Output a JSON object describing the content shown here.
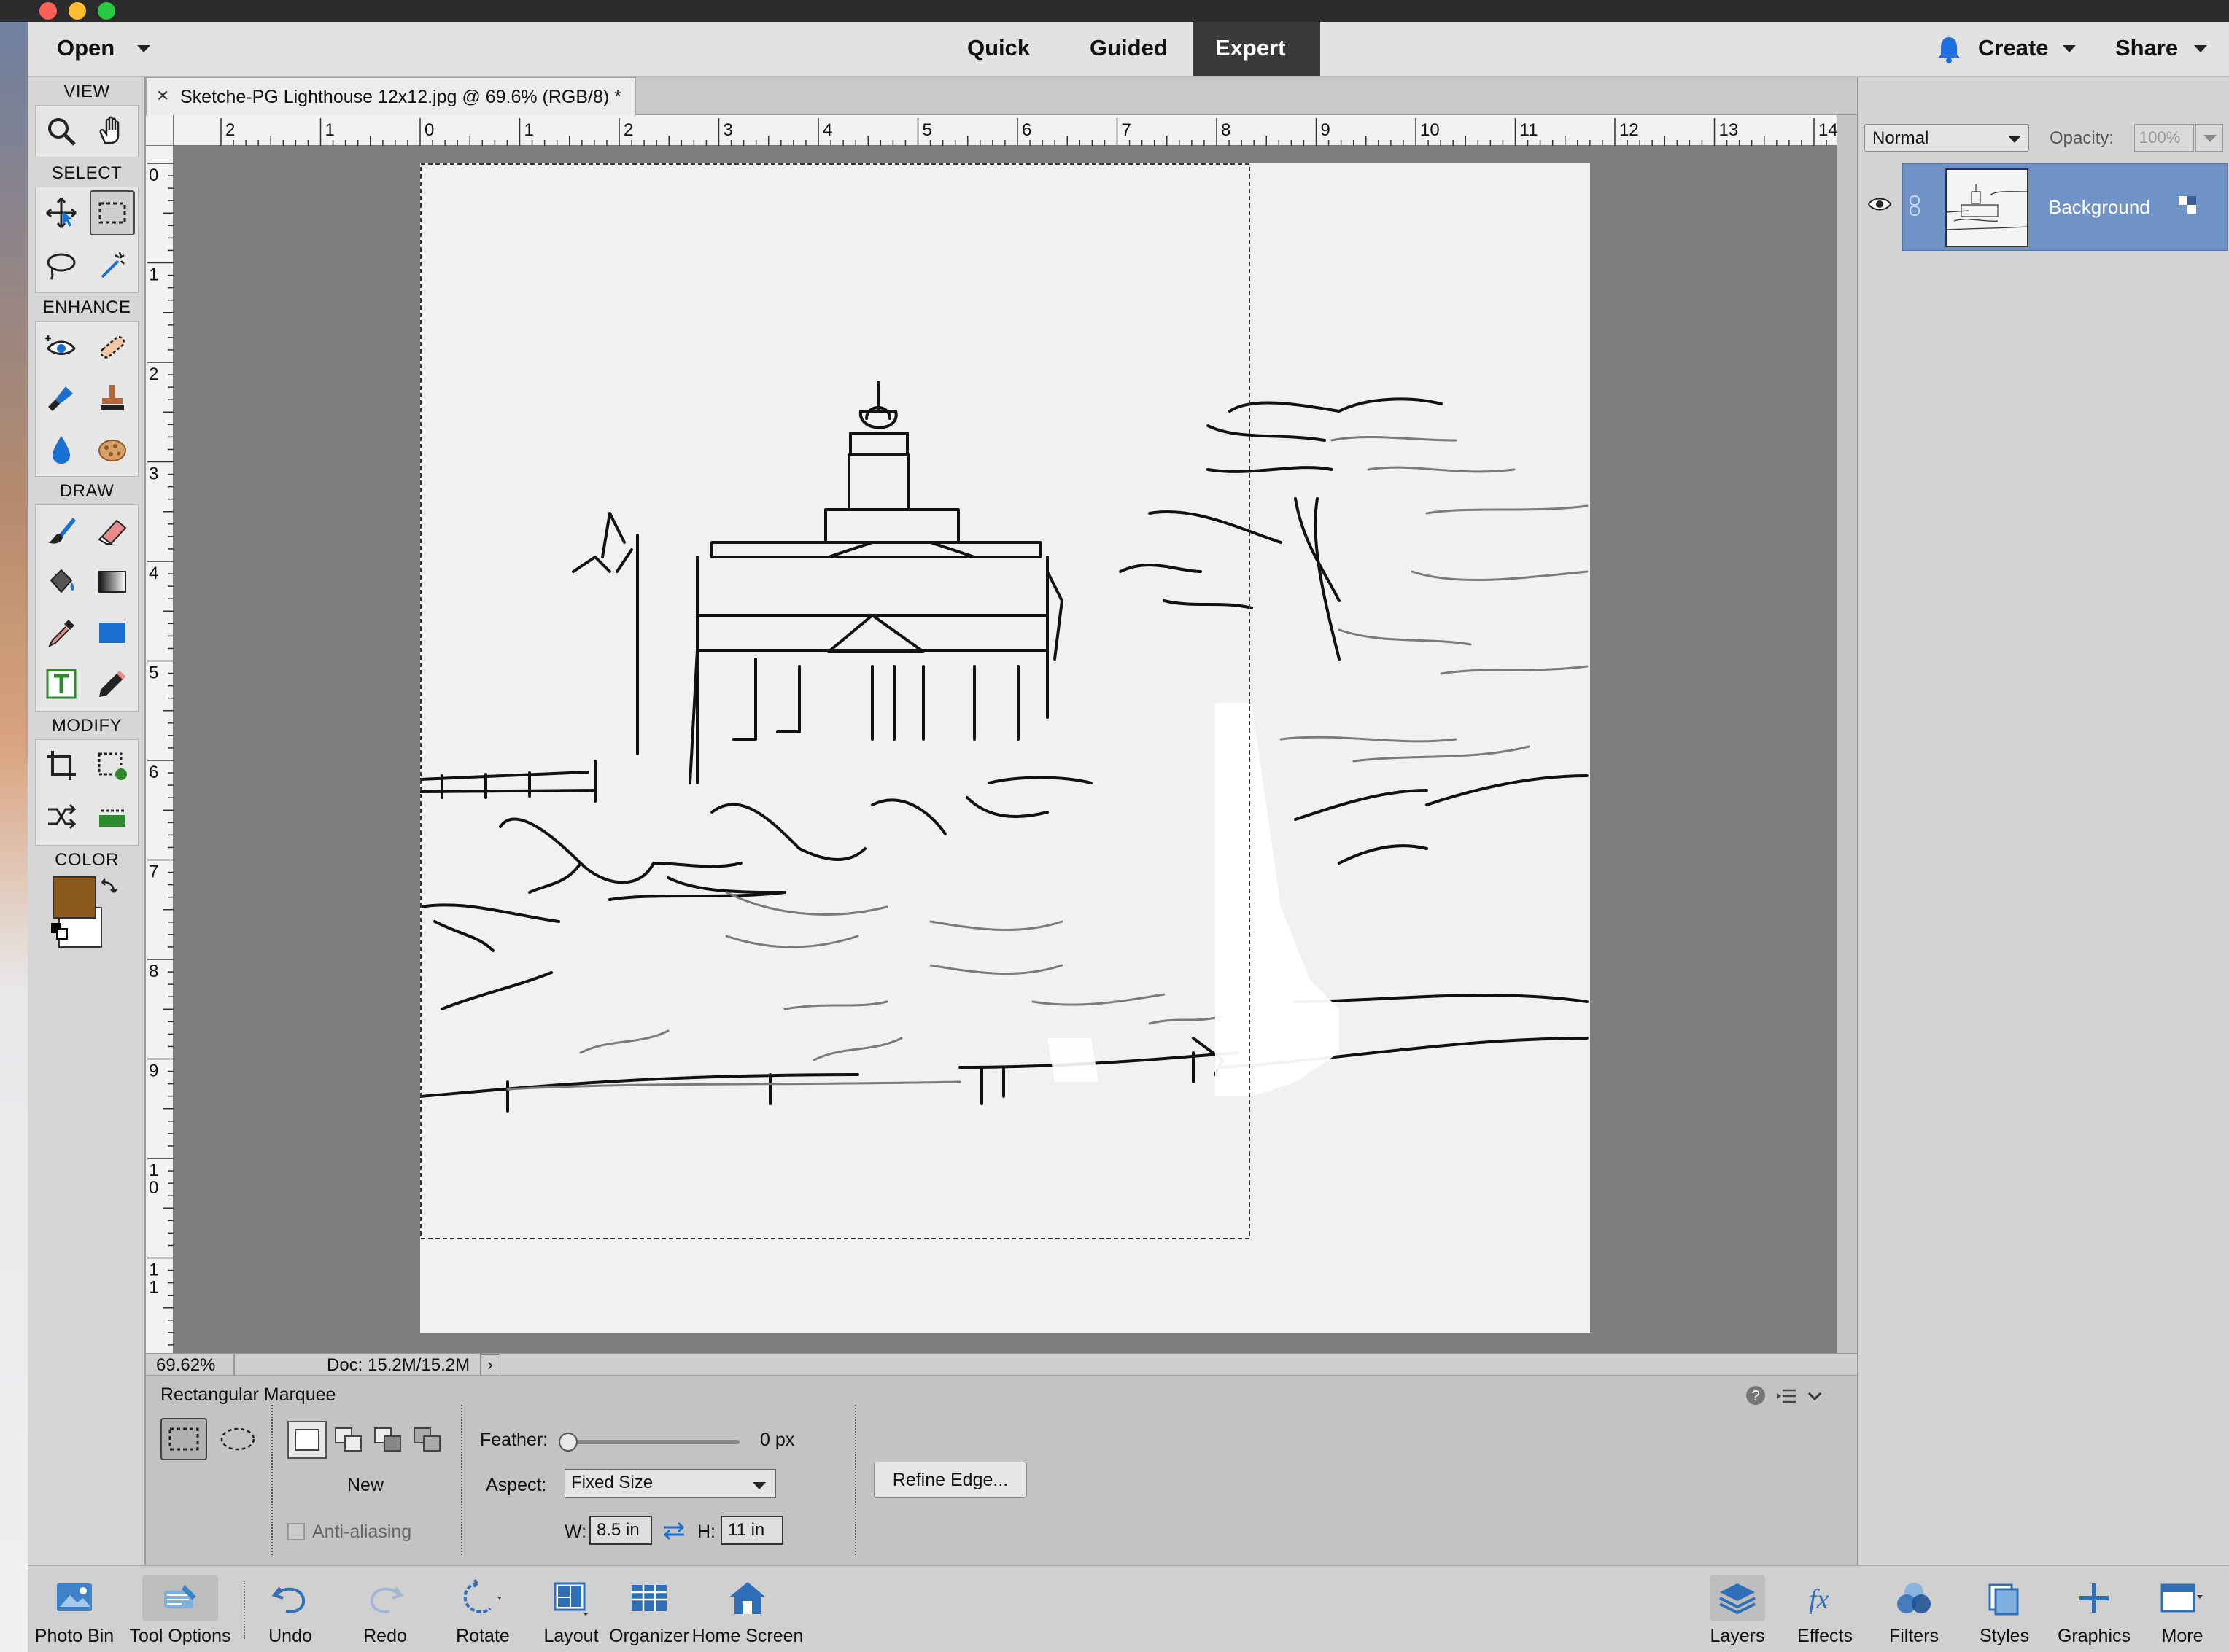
{
  "menubar": {
    "open_label": "Open",
    "modes": [
      "Quick",
      "Guided",
      "Expert"
    ],
    "active_mode": "Expert",
    "create_label": "Create",
    "share_label": "Share"
  },
  "document": {
    "tab_title": "Sketche-PG Lighthouse 12x12.jpg @ 69.6% (RGB/8) *",
    "close_glyph": "×"
  },
  "tools": {
    "sections": [
      "VIEW",
      "SELECT",
      "ENHANCE",
      "DRAW",
      "MODIFY",
      "COLOR"
    ],
    "foreground_color": "#8B5A1B",
    "background_color": "#ffffff"
  },
  "rulers": {
    "horizontal": [
      "2",
      "1",
      "0",
      "1",
      "2",
      "3",
      "4",
      "5",
      "6",
      "7",
      "8",
      "9",
      "10",
      "11",
      "12",
      "13",
      "14"
    ],
    "vertical": [
      "0",
      "1",
      "2",
      "3",
      "4",
      "5",
      "6",
      "7",
      "8",
      "9",
      "1\n0",
      "1\n1",
      "1"
    ]
  },
  "status": {
    "zoom": "69.62%",
    "doc_size": "Doc: 15.2M/15.2M"
  },
  "tool_options": {
    "tool_name": "Rectangular Marquee",
    "mode_label": "New",
    "anti_aliasing_label": "Anti-aliasing",
    "feather_label": "Feather:",
    "feather_value": "0 px",
    "feather_fraction": 0,
    "aspect_label": "Aspect:",
    "aspect_value": "Fixed Size",
    "width_label": "W:",
    "width_value": "8.5 in",
    "height_label": "H:",
    "height_value": "11 in",
    "refine_edge_label": "Refine Edge..."
  },
  "layers": {
    "blend_mode": "Normal",
    "opacity_label": "Opacity:",
    "opacity_value": "100%",
    "items": [
      {
        "name": "Background"
      }
    ]
  },
  "bottombar": {
    "left": [
      "Photo Bin",
      "Tool Options",
      "Undo",
      "Redo",
      "Rotate",
      "Layout",
      "Organizer",
      "Home Screen"
    ],
    "right": [
      "Layers",
      "Effects",
      "Filters",
      "Styles",
      "Graphics",
      "More"
    ]
  }
}
